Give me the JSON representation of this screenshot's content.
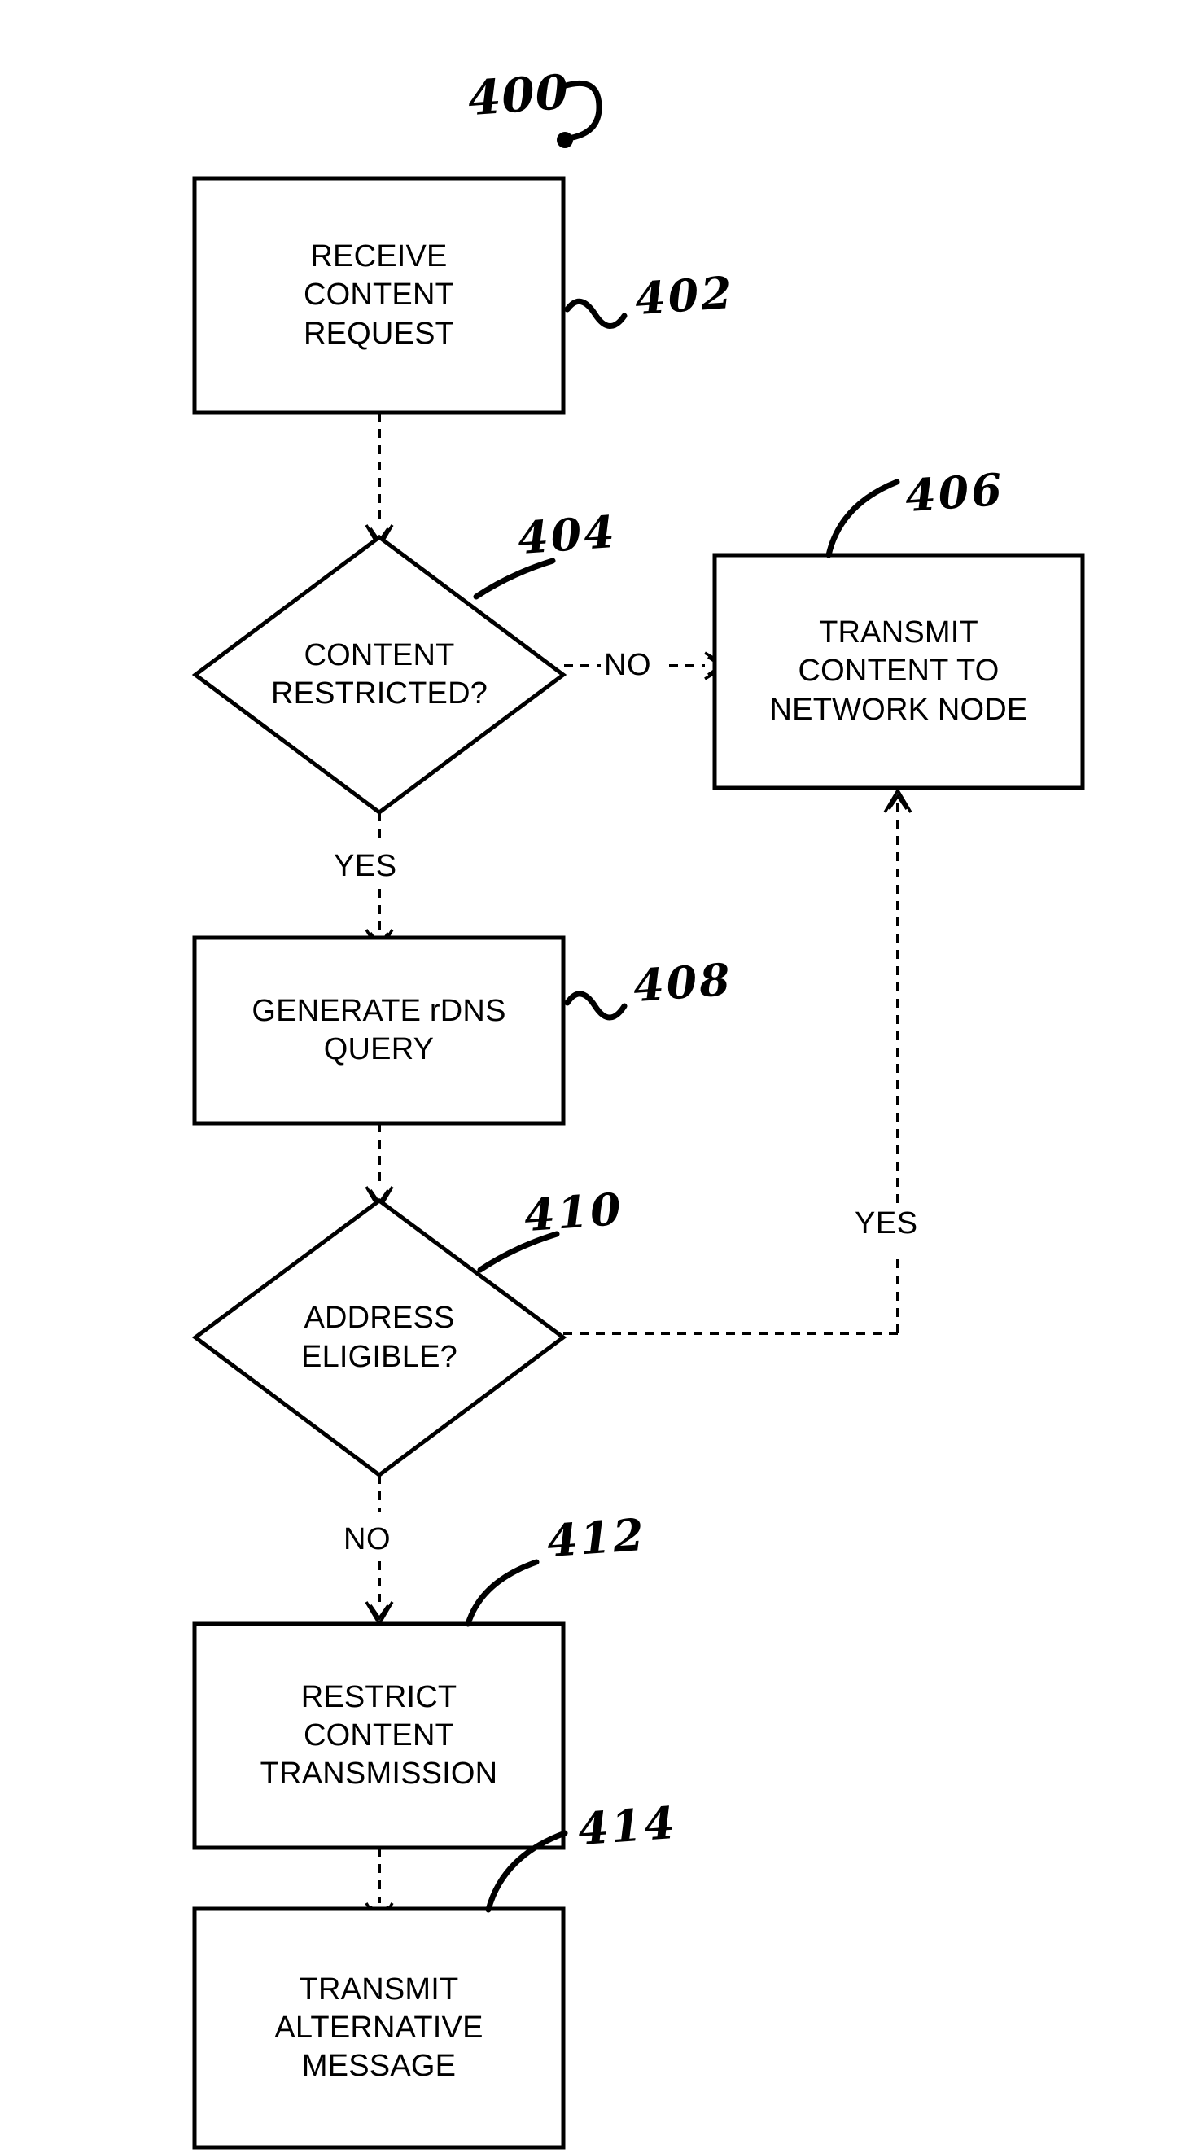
{
  "figure": {
    "figure_number": "400",
    "type": "patent-flowchart"
  },
  "nodes": [
    {
      "id": "402",
      "shape": "process",
      "ref": "402",
      "ref_prefix": "~",
      "lines": [
        "RECEIVE",
        "CONTENT",
        "REQUEST"
      ]
    },
    {
      "id": "404",
      "shape": "decision",
      "ref": "404",
      "ref_prefix": "",
      "lines": [
        "CONTENT",
        "RESTRICTED?"
      ]
    },
    {
      "id": "406",
      "shape": "process",
      "ref": "406",
      "ref_prefix": "",
      "lines": [
        "TRANSMIT",
        "CONTENT TO",
        "NETWORK NODE"
      ]
    },
    {
      "id": "408",
      "shape": "process",
      "ref": "408",
      "ref_prefix": "~",
      "lines": [
        "GENERATE rDNS",
        "QUERY"
      ]
    },
    {
      "id": "410",
      "shape": "decision",
      "ref": "410",
      "ref_prefix": "",
      "lines": [
        "ADDRESS",
        "ELIGIBLE?"
      ]
    },
    {
      "id": "412",
      "shape": "process",
      "ref": "412",
      "ref_prefix": "",
      "lines": [
        "RESTRICT",
        "CONTENT",
        "TRANSMISSION"
      ]
    },
    {
      "id": "414",
      "shape": "process",
      "ref": "414",
      "ref_prefix": "",
      "lines": [
        "TRANSMIT",
        "ALTERNATIVE",
        "MESSAGE"
      ]
    }
  ],
  "branches": {
    "no_404": "NO",
    "yes_404": "YES",
    "yes_410": "YES",
    "no_410": "NO"
  },
  "style": {
    "stroke": "#000000",
    "background": "#ffffff"
  }
}
